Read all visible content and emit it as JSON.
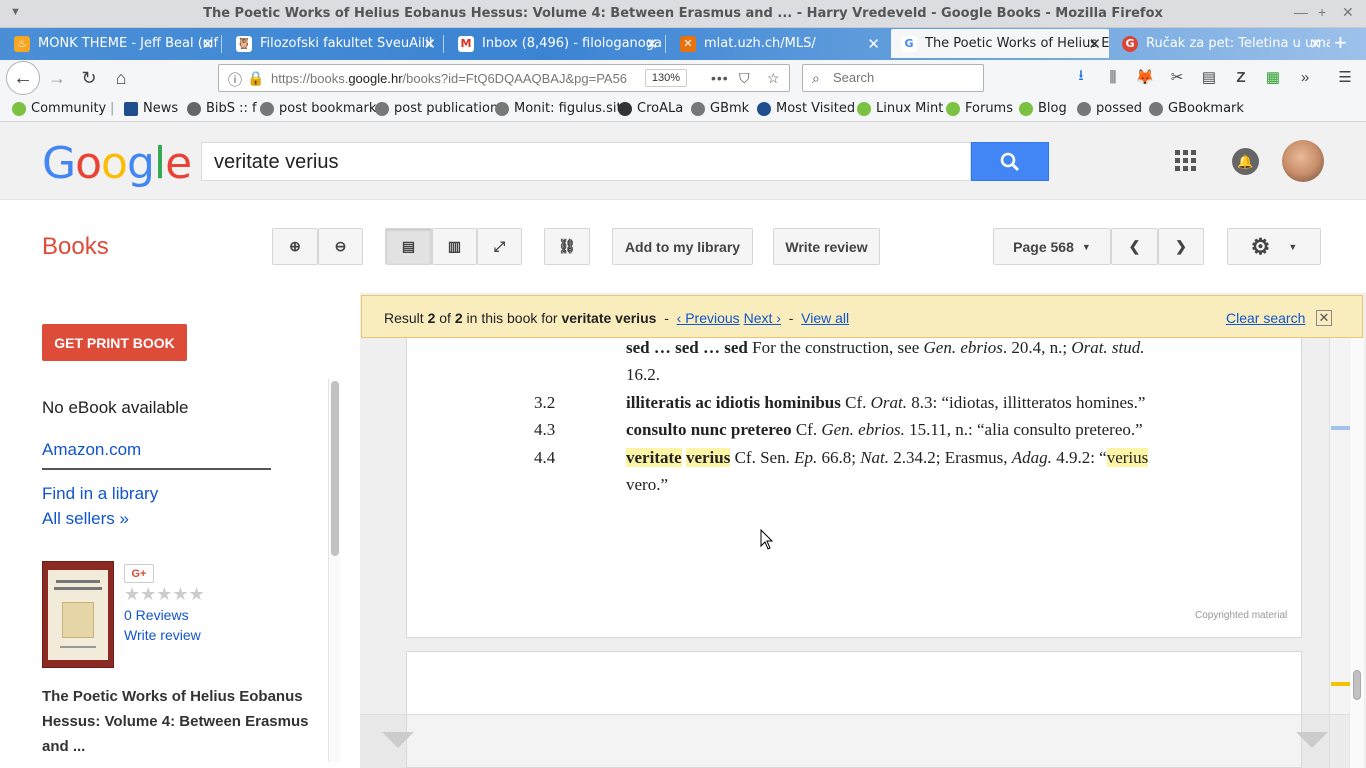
{
  "window": {
    "title": "The Poetic Works of Helius Eobanus Hessus: Volume 4: Between Erasmus and ... - Harry Vredeveld - Google Books - Mozilla Firefox"
  },
  "tabs": [
    {
      "label": "MONK THEME - Jeff Beal (cif",
      "icon": "flame-icon",
      "color": "#f5a623"
    },
    {
      "label": "Filozofski fakultet SveuÄilil",
      "icon": "owl-icon",
      "color": "#333333"
    },
    {
      "label": "Inbox (8,496) - filologanoga",
      "icon": "gmail-icon",
      "color": "#d93025"
    },
    {
      "label": "mlat.uzh.ch/MLS/",
      "icon": "xampp-icon",
      "color": "#e8730c"
    },
    {
      "label": "The Poetic Works of Helius E",
      "icon": "google-icon",
      "color": "#4285f4"
    },
    {
      "label": "Ručak za pet: Teletina u uma",
      "icon": "google-red-icon",
      "color": "#db4437"
    }
  ],
  "navbar": {
    "url_prefix": "https://books.",
    "url_domain": "google.hr",
    "url_suffix": "/books?id=FtQ6DQAAQBAJ&pg=PA56",
    "zoom": "130%",
    "search_placeholder": "Search"
  },
  "bookmarks": [
    {
      "label": "Community",
      "color": "#7bc142"
    },
    {
      "label": "News",
      "color": "#1f4e8c"
    },
    {
      "label": "BibS :: f",
      "color": "#666666"
    },
    {
      "label": "post bookmark",
      "color": "#777777"
    },
    {
      "label": "post publication",
      "color": "#777777"
    },
    {
      "label": "Monit: figulus.sit",
      "color": "#777777"
    },
    {
      "label": "CroALa",
      "color": "#333333"
    },
    {
      "label": "GBmk",
      "color": "#777777"
    },
    {
      "label": "Most Visited",
      "color": "#1f4e8c"
    },
    {
      "label": "Linux Mint",
      "color": "#7bc142"
    },
    {
      "label": "Forums",
      "color": "#7bc142"
    },
    {
      "label": "Blog",
      "color": "#7bc142"
    },
    {
      "label": "possed",
      "color": "#777777"
    },
    {
      "label": "GBookmark",
      "color": "#777777"
    }
  ],
  "google": {
    "logo": "Google",
    "query": "veritate verius"
  },
  "books_toolbar": {
    "title": "Books",
    "add_library": "Add to my library",
    "write_review": "Write review",
    "page_label": "Page 568"
  },
  "sidebar": {
    "get_print": "GET PRINT BOOK",
    "no_ebook": "No eBook available",
    "amazon": "Amazon.com",
    "find_library": "Find in a library",
    "all_sellers": "All sellers »",
    "gplus": "G+",
    "reviews": "0 Reviews",
    "write_review": "Write review",
    "book_title": "The Poetic Works of Helius Eobanus Hessus: Volume 4: Between Erasmus and ...",
    "rating": 0
  },
  "resultbar": {
    "result_prefix": "Result ",
    "result_num": "2",
    "of": " of ",
    "result_total": "2",
    "in_book_for": " in this book for ",
    "query": "veritate verius",
    "sep": "  -  ",
    "previous": "‹ Previous",
    "next": "Next ›",
    "view_all": "View all",
    "clear": "Clear search"
  },
  "page": {
    "line1_bold": "sed … sed … sed",
    "line1_rest_a": " For the construction, see ",
    "line1_ital_a": "Gen. ebrios",
    "line1_rest_b": ". 20.4, n.; ",
    "line1_ital_b": "Orat. stud.",
    "line2": "16.2.",
    "ref3": "3.2",
    "line3_bold": "illiteratis ac idiotis hominibus",
    "line3_rest_a": " Cf. ",
    "line3_ital": "Orat.",
    "line3_rest_b": " 8.3: “idiotas, illitteratos homines.”",
    "ref4": "4.3",
    "line4_bold": "consulto nunc pretereo",
    "line4_rest_a": " Cf. ",
    "line4_ital": "Gen. ebrios.",
    "line4_rest_b": " 15.11, n.: “alia consulto pretereo.”",
    "ref5": "4.4",
    "line5_hl1": "veritate",
    "line5_hl2": "verius",
    "line5_a": " Cf. Sen. ",
    "line5_ital_a": "Ep.",
    "line5_b": " 66.8; ",
    "line5_ital_b": "Nat.",
    "line5_c": " 2.34.2; Erasmus, ",
    "line5_ital_c": "Adag.",
    "line5_d": " 4.9.2: “",
    "line5_hl3": "verius",
    "line6": "vero.”",
    "copyright": "Copyrighted material"
  }
}
